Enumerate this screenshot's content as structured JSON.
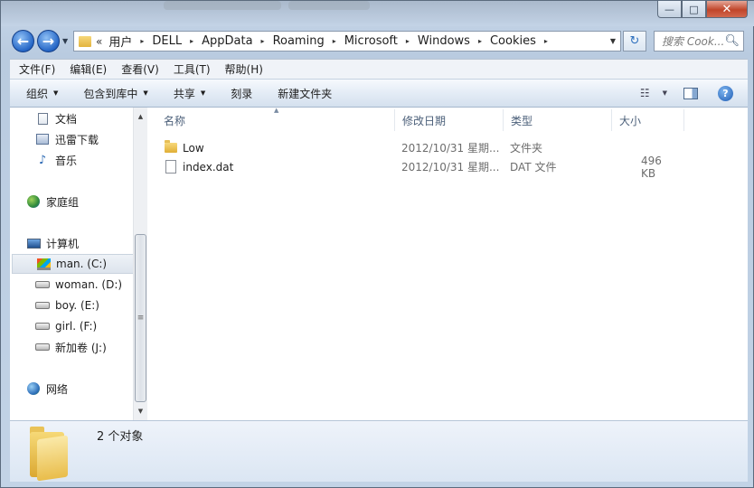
{
  "window": {
    "minimize_glyph": "—",
    "maximize_glyph": "□",
    "close_glyph": "✕"
  },
  "nav": {
    "back_glyph": "←",
    "forward_glyph": "→",
    "history_glyph": "▼",
    "address_chevron": "«",
    "breadcrumbs": [
      "用户",
      "DELL",
      "AppData",
      "Roaming",
      "Microsoft",
      "Windows",
      "Cookies"
    ],
    "crumb_separator": "▸",
    "address_dropdown_glyph": "▼",
    "refresh_glyph": "↻",
    "search_placeholder": "搜索 Cook...",
    "search_icon": "magnifier-icon"
  },
  "menubar": {
    "items": [
      "文件(F)",
      "编辑(E)",
      "查看(V)",
      "工具(T)",
      "帮助(H)"
    ]
  },
  "toolbar": {
    "organize": "组织",
    "include_library": "包含到库中",
    "share": "共享",
    "burn": "刻录",
    "new_folder": "新建文件夹",
    "dropdown_glyph": "▼",
    "help_glyph": "?"
  },
  "sidebar": {
    "items": [
      {
        "label": "文档",
        "icon": "documents-icon"
      },
      {
        "label": "迅雷下载",
        "icon": "library-icon"
      },
      {
        "label": "音乐",
        "icon": "music-icon"
      },
      {
        "label": "家庭组",
        "icon": "homegroup-icon"
      },
      {
        "label": "计算机",
        "icon": "computer-icon"
      },
      {
        "label": "man. (C:)",
        "icon": "system-drive-icon",
        "selected": true
      },
      {
        "label": "woman. (D:)",
        "icon": "drive-icon"
      },
      {
        "label": "boy. (E:)",
        "icon": "drive-icon"
      },
      {
        "label": "girl. (F:)",
        "icon": "drive-icon"
      },
      {
        "label": "新加卷 (J:)",
        "icon": "drive-icon"
      },
      {
        "label": "网络",
        "icon": "network-icon"
      }
    ],
    "scroll_up": "▲",
    "scroll_down": "▼",
    "thumb_grip": "≡"
  },
  "content": {
    "columns": [
      "名称",
      "修改日期",
      "类型",
      "大小"
    ],
    "sort_glyph": "▲",
    "rows": [
      {
        "name": "Low",
        "date": "2012/10/31 星期...",
        "type": "文件夹",
        "size": "",
        "icon": "folder-icon"
      },
      {
        "name": "index.dat",
        "date": "2012/10/31 星期...",
        "type": "DAT 文件",
        "size": "496 KB",
        "icon": "file-icon"
      }
    ]
  },
  "details": {
    "count": "2 个对象"
  }
}
